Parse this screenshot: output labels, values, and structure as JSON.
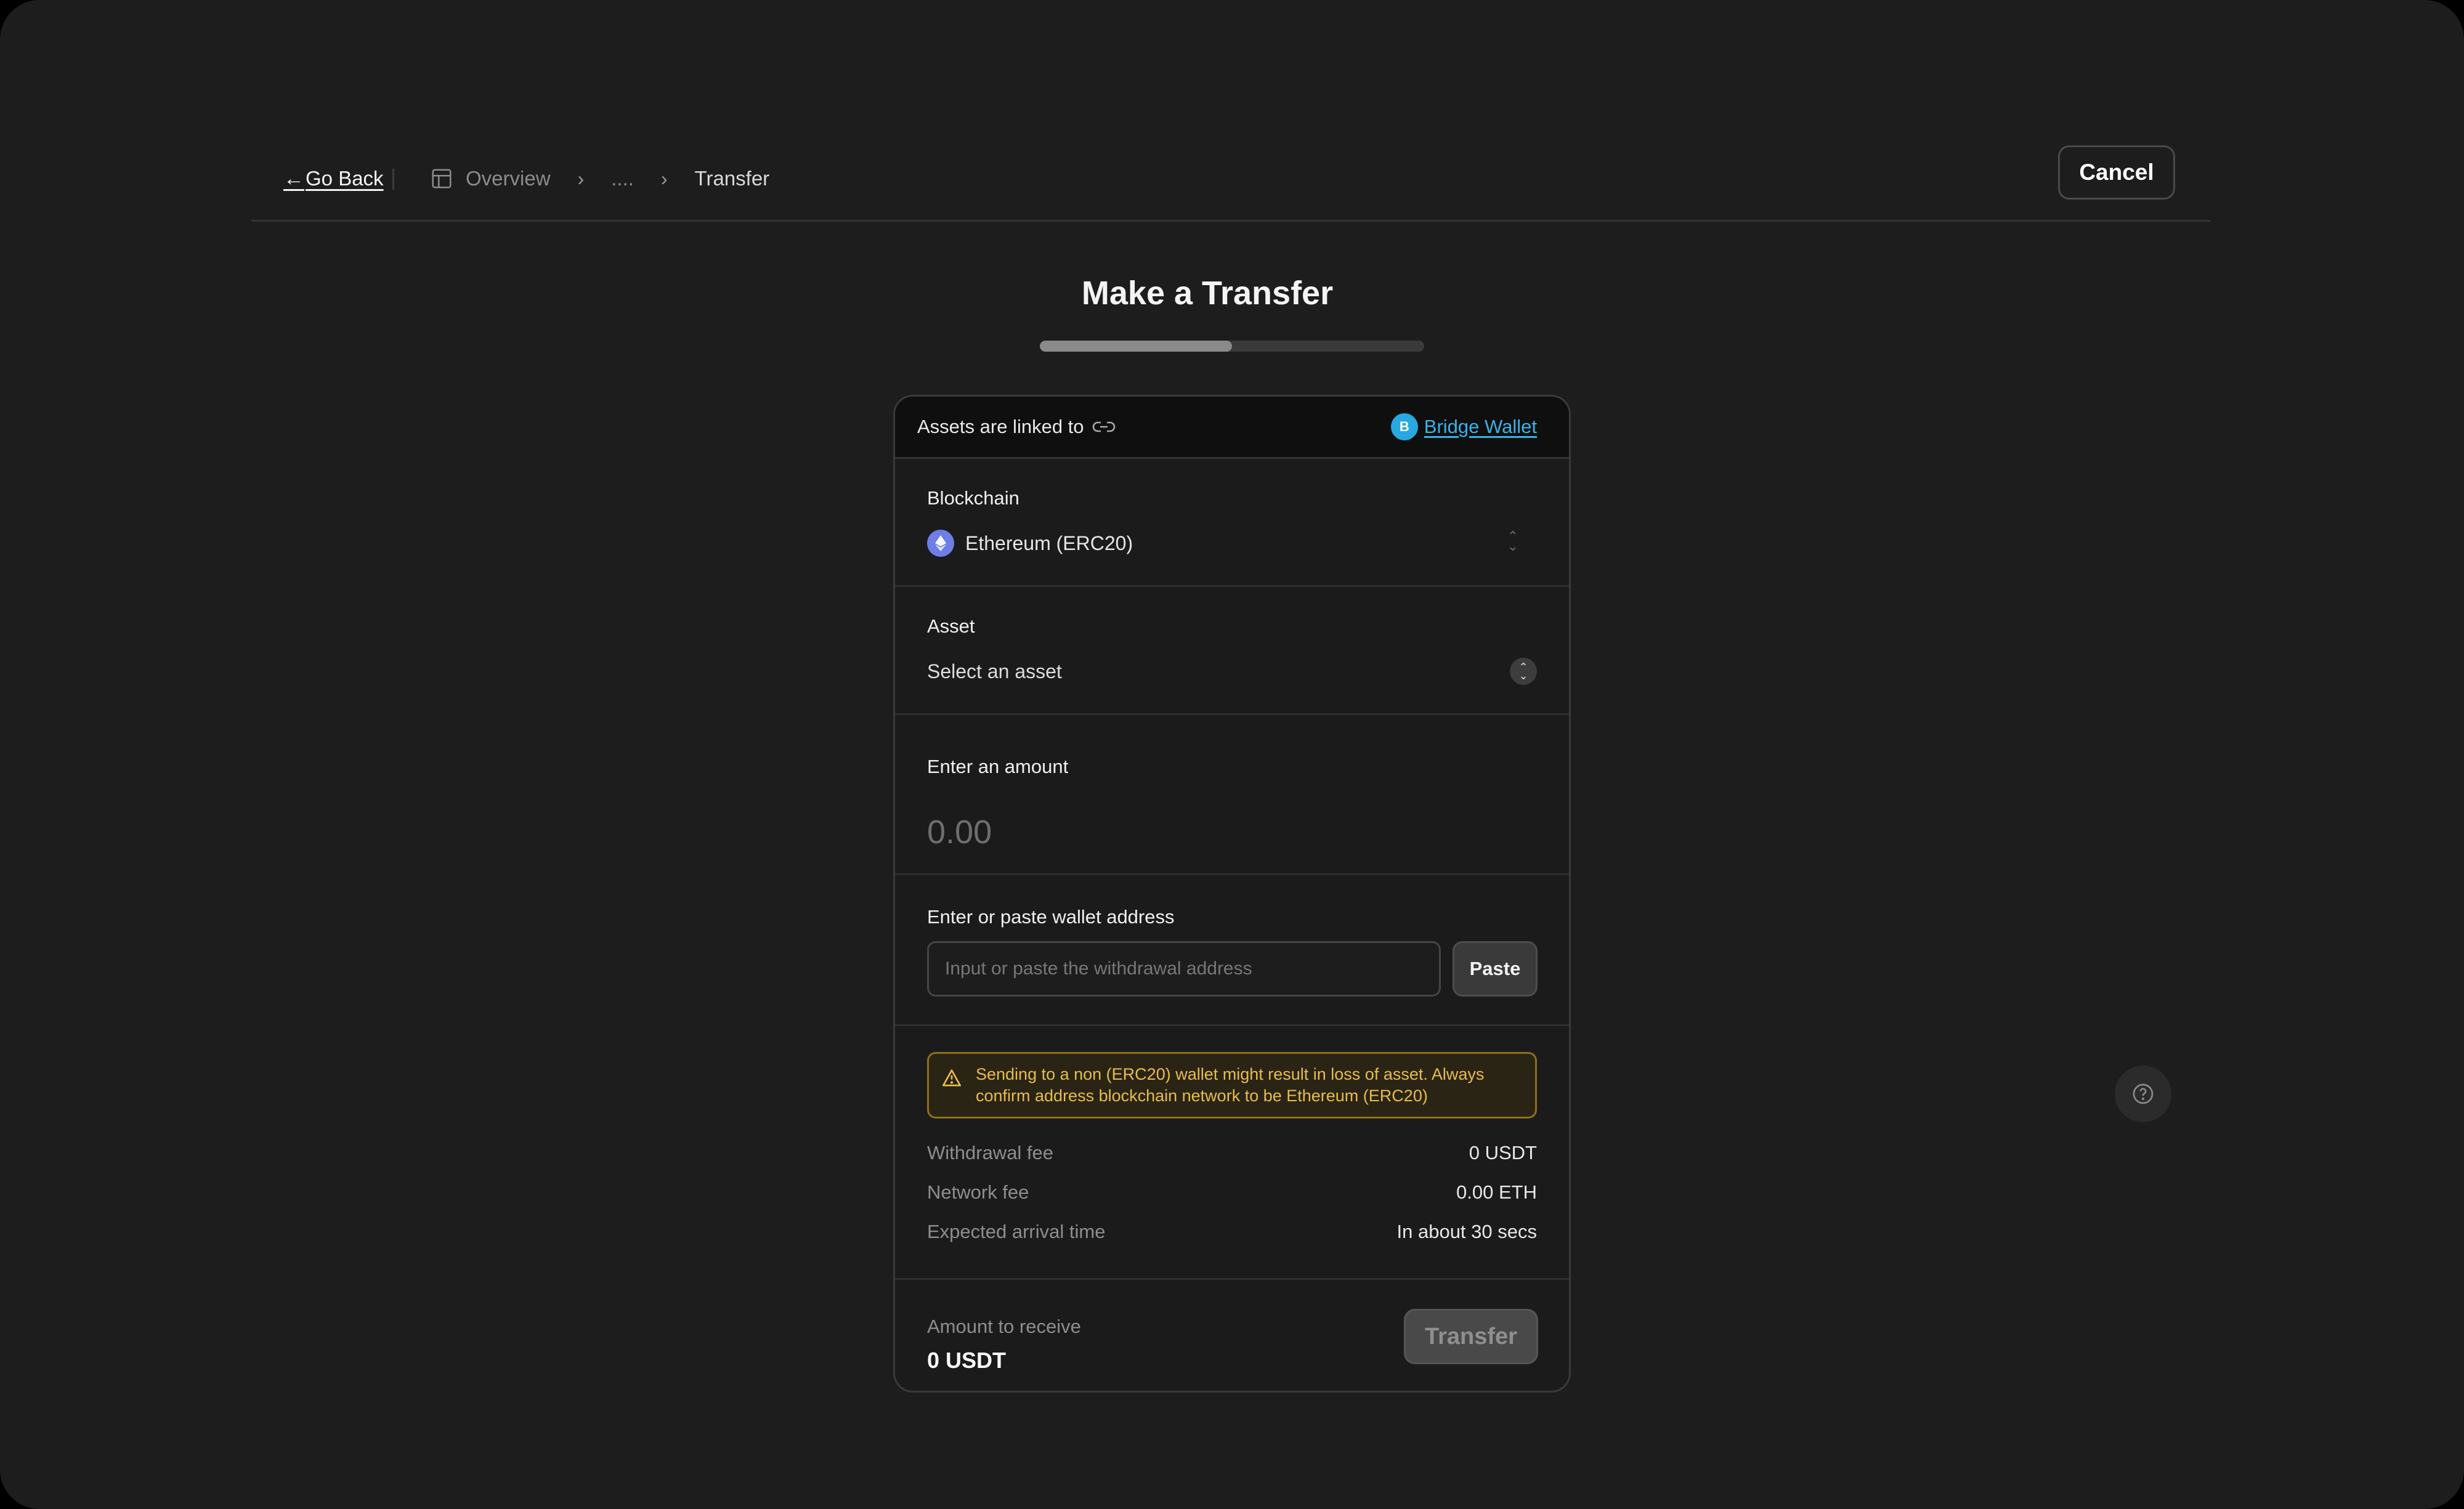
{
  "header": {
    "back_label": "Go Back",
    "breadcrumb": {
      "overview": "Overview",
      "ellipsis": "....",
      "current": "Transfer"
    },
    "cancel_label": "Cancel"
  },
  "page": {
    "title": "Make a Transfer",
    "progress_fraction": 0.5
  },
  "card": {
    "linked_text": "Assets are linked to",
    "wallet_badge": "B",
    "wallet_name": "Bridge Wallet",
    "blockchain": {
      "label": "Blockchain",
      "value": "Ethereum (ERC20)"
    },
    "asset": {
      "label": "Asset",
      "value": "Select an asset"
    },
    "amount": {
      "label": "Enter an amount",
      "placeholder": "0.00"
    },
    "address": {
      "label": "Enter or paste wallet address",
      "placeholder": "Input or paste the withdrawal address",
      "paste_label": "Paste"
    },
    "warning_text": "Sending to a non (ERC20) wallet might result in loss of asset. Always confirm address blockchain network to be Ethereum (ERC20)",
    "fees": [
      {
        "label": "Withdrawal fee",
        "value": "0 USDT"
      },
      {
        "label": "Network fee",
        "value": "0.00 ETH"
      },
      {
        "label": "Expected arrival time",
        "value": "In about 30 secs"
      }
    ],
    "receive": {
      "label": "Amount to receive",
      "value": "0 USDT"
    },
    "transfer_label": "Transfer"
  },
  "colors": {
    "background": "#1d1d1d",
    "wallet_link": "#39b3ea",
    "warning_border": "#8f6f1a",
    "warning_text": "#e8bd4e",
    "ethereum": "#6d7fe6"
  },
  "icons": [
    "arrow-left-icon",
    "layout-icon",
    "chevron-right-icon",
    "link-icon",
    "ethereum-icon",
    "updown-icon",
    "warning-icon",
    "help-icon"
  ]
}
